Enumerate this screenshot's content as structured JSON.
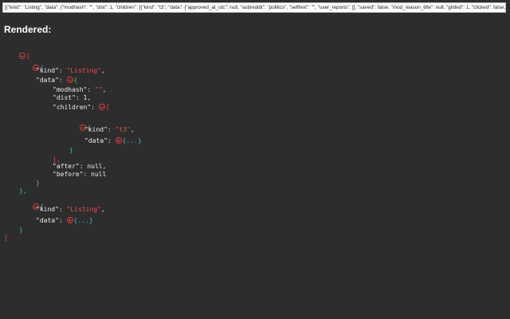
{
  "raw_json_preview": "[{\"kind\": \"Listing\", \"data\": {\"modhash\": \"\", \"dist\": 1, \"children\": [{\"kind\": \"t3\", \"data\": {\"approved_at_utc\": null, \"subreddit\": \"politics\", \"selftext\": \"\", \"user_reports\": [], \"saved\": false, \"mod_reason_title\": null, \"gilded\": 1, \"clicked\": false, \"title\": \"The entire country should be grateful for Fiona Hill\\u2019s commitment to the truth\", \"link_flair_richtext\": [], \"subreddit_name_prefixed\": \"r/politics\", \"hidden\": false, \"pwls\": 6, \"link_flair_css_class\": null, \"downs\": 0,",
  "heading": "Rendered:",
  "tree": {
    "open_bracket": "[",
    "close_bracket": "]",
    "open_brace": "{",
    "close_brace": "}",
    "close_brace_comma": "},",
    "close_bracket_comma": "],",
    "colon": ": ",
    "comma": ",",
    "collapsed": "{...}",
    "listing1": {
      "kind_key": "\"kind\"",
      "kind_value": "\"Listing\"",
      "data_key": "\"data\"",
      "modhash_key": "\"modhash\"",
      "modhash_value": "\"\"",
      "dist_key": "\"dist\"",
      "dist_value": "1",
      "children_key": "\"children\"",
      "child": {
        "kind_key": "\"kind\"",
        "kind_value": "\"t3\"",
        "data_key": "\"data\""
      },
      "after_key": "\"after\"",
      "after_value": "null",
      "before_key": "\"before\"",
      "before_value": "null"
    },
    "listing2": {
      "kind_key": "\"kind\"",
      "kind_value": "\"Listing\"",
      "data_key": "\"data\""
    }
  },
  "colors": {
    "background": "#2d2d2d",
    "string": "#f04b4b",
    "toggle": "#e03a3a",
    "collapsed_text": "#3fb8c8"
  },
  "icons": {
    "collapse": "circle-minus",
    "expand": "circle-plus"
  }
}
